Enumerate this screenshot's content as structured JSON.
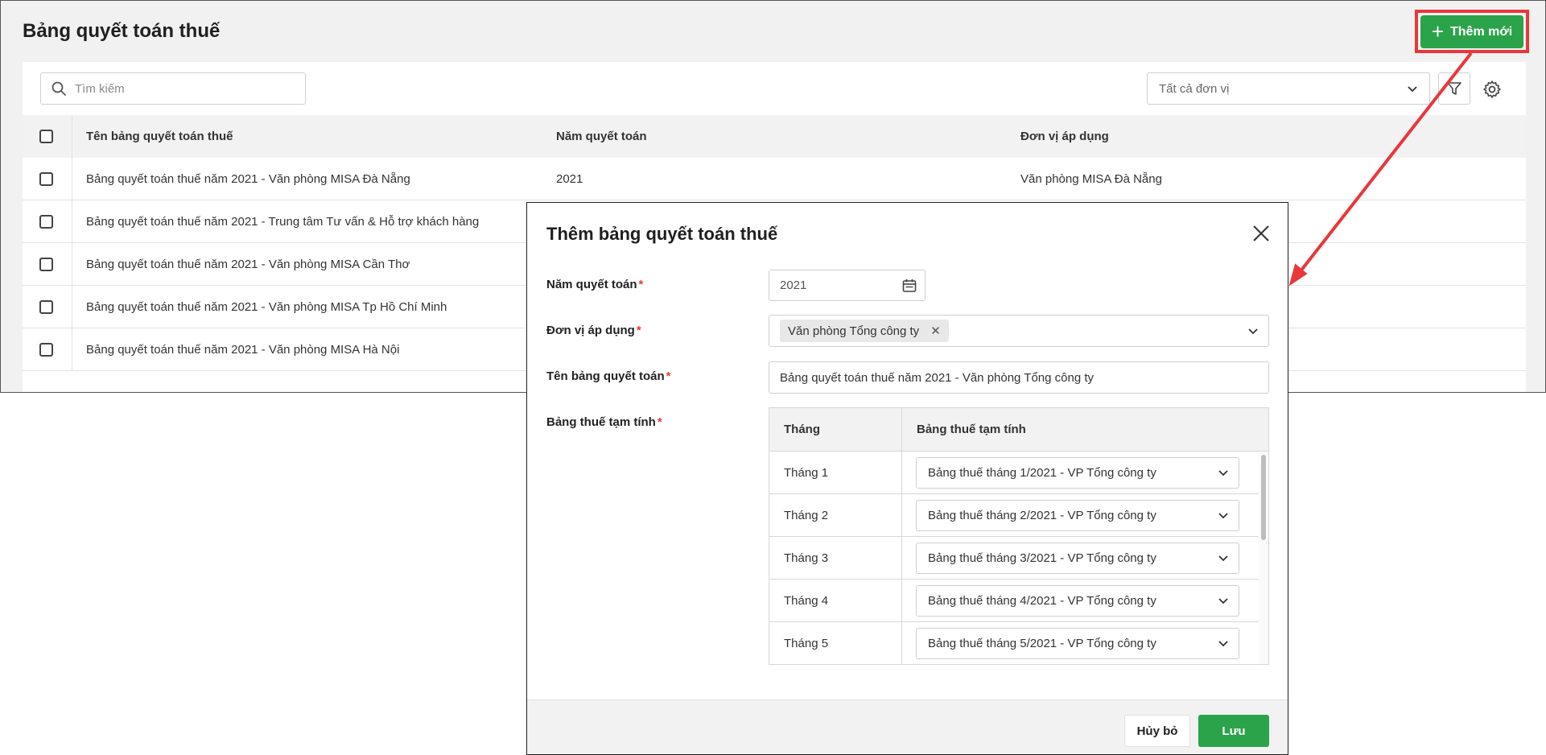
{
  "page": {
    "title": "Bảng quyết toán thuế",
    "add_button_label": "Thêm mới",
    "search_placeholder": "Tìm kiếm",
    "unit_filter_value": "Tất cả đơn vị"
  },
  "table": {
    "columns": [
      "Tên bảng quyết toán thuế",
      "Năm quyết toán",
      "Đơn vị áp dụng"
    ],
    "rows": [
      {
        "name": "Bảng quyết toán thuế năm 2021 - Văn phòng MISA Đà Nẵng",
        "year": "2021",
        "unit": "Văn phòng MISA Đà Nẵng"
      },
      {
        "name": "Bảng quyết toán thuế năm 2021 - Trung tâm Tư vấn & Hỗ trợ khách hàng",
        "year": "",
        "unit": ""
      },
      {
        "name": "Bảng quyết toán thuế năm 2021 - Văn phòng MISA Cần Thơ",
        "year": "",
        "unit": ""
      },
      {
        "name": "Bảng quyết toán thuế năm 2021 - Văn phòng MISA Tp Hồ Chí Minh",
        "year": "",
        "unit": ""
      },
      {
        "name": "Bảng quyết toán thuế năm 2021 - Văn phòng MISA Hà Nội",
        "year": "",
        "unit": ""
      }
    ]
  },
  "modal": {
    "title": "Thêm bảng quyết toán thuế",
    "year_label": "Năm quyết toán",
    "year_value": "2021",
    "unit_label": "Đơn vị áp dụng",
    "unit_tag": "Văn phòng Tổng công ty",
    "name_label": "Tên bảng quyết toán",
    "name_value": "Bảng quyết toán thuế năm 2021 - Văn phòng Tổng công ty",
    "tax_label": "Bảng thuế tạm tính",
    "required_mark": "*",
    "tax_table": {
      "col_month": "Tháng",
      "col_table": "Bảng thuế tạm tính",
      "rows": [
        {
          "month": "Tháng 1",
          "table": "Bảng thuế tháng 1/2021 - VP Tổng công ty"
        },
        {
          "month": "Tháng 2",
          "table": "Bảng thuế tháng 2/2021 - VP Tổng công ty"
        },
        {
          "month": "Tháng 3",
          "table": "Bảng thuế tháng 3/2021 - VP Tổng công ty"
        },
        {
          "month": "Tháng 4",
          "table": "Bảng thuế tháng 4/2021 - VP Tổng công ty"
        },
        {
          "month": "Tháng 5",
          "table": "Bảng thuế tháng 5/2021 - VP Tổng công ty"
        }
      ]
    },
    "cancel_label": "Hủy bỏ",
    "save_label": "Lưu"
  },
  "colors": {
    "primary_green": "#2ba34a",
    "highlight_red": "#e8373d",
    "required_red": "#e53935"
  }
}
